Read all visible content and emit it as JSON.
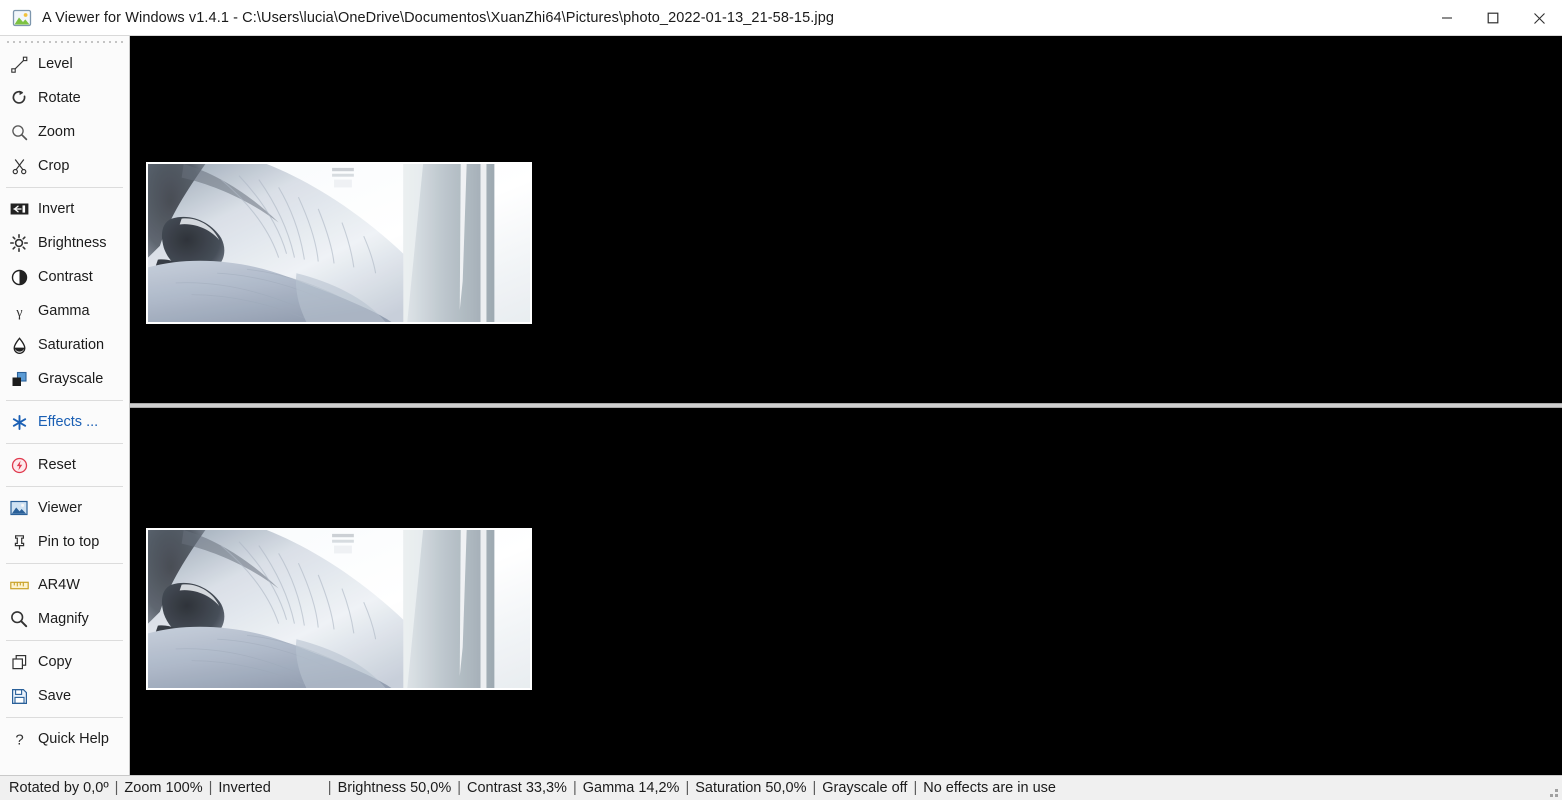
{
  "window": {
    "title": "A Viewer for Windows v1.4.1 - C:\\Users\\lucia\\OneDrive\\Documentos\\XuanZhi64\\Pictures\\photo_2022-01-13_21-58-15.jpg",
    "app_icon": "picture-icon",
    "controls": {
      "minimize": "minimize-icon",
      "maximize": "maximize-icon",
      "close": "close-icon"
    }
  },
  "sidebar": {
    "grip": "drag-handle",
    "groups": [
      {
        "items": [
          {
            "label": "Level",
            "icon": "level-line-icon"
          },
          {
            "label": "Rotate",
            "icon": "rotate-icon"
          },
          {
            "label": "Zoom",
            "icon": "magnifier-icon"
          },
          {
            "label": "Crop",
            "icon": "scissors-icon"
          }
        ]
      },
      {
        "items": [
          {
            "label": "Invert",
            "icon": "invert-icon"
          },
          {
            "label": "Brightness",
            "icon": "sun-icon"
          },
          {
            "label": "Contrast",
            "icon": "contrast-circle-icon"
          },
          {
            "label": "Gamma",
            "icon": "gamma-icon"
          },
          {
            "label": "Saturation",
            "icon": "droplet-icon"
          },
          {
            "label": "Grayscale",
            "icon": "squares-icon"
          }
        ]
      },
      {
        "items": [
          {
            "label": "Effects ...",
            "icon": "asterisk-icon",
            "accent": true
          }
        ]
      },
      {
        "items": [
          {
            "label": "Reset",
            "icon": "reset-bolt-icon"
          }
        ]
      },
      {
        "items": [
          {
            "label": "Viewer",
            "icon": "viewer-image-icon"
          },
          {
            "label": "Pin to top",
            "icon": "pin-icon"
          }
        ]
      },
      {
        "items": [
          {
            "label": "AR4W",
            "icon": "ruler-icon"
          },
          {
            "label": "Magnify",
            "icon": "magnifier-icon"
          }
        ]
      },
      {
        "items": [
          {
            "label": "Copy",
            "icon": "copy-icon"
          },
          {
            "label": "Save",
            "icon": "floppy-disk-icon"
          }
        ]
      },
      {
        "items": [
          {
            "label": "Quick Help",
            "icon": "question-mark-icon"
          }
        ]
      }
    ]
  },
  "viewer": {
    "top_pane": {
      "name": "original-image-pane",
      "alt": "Gray tabby cat lying by a bright window"
    },
    "bottom_pane": {
      "name": "preview-image-pane",
      "alt": "Gray tabby cat lying by a bright window"
    },
    "background": "#000000",
    "divider": "pane-splitter"
  },
  "statusbar": {
    "rotated": "Rotated by 0,0º",
    "zoom": "Zoom 100%",
    "inverted": "Inverted",
    "brightness": "Brightness 50,0%",
    "contrast": "Contrast 33,3%",
    "gamma": "Gamma 14,2%",
    "saturation": "Saturation 50,0%",
    "grayscale": "Grayscale off",
    "effects": "No effects are in use",
    "separator": "|"
  },
  "colors": {
    "accent_blue": "#1a5fb4",
    "reset_red": "#e03a4e",
    "ruler_gold": "#c9a227",
    "canvas_black": "#000000"
  }
}
